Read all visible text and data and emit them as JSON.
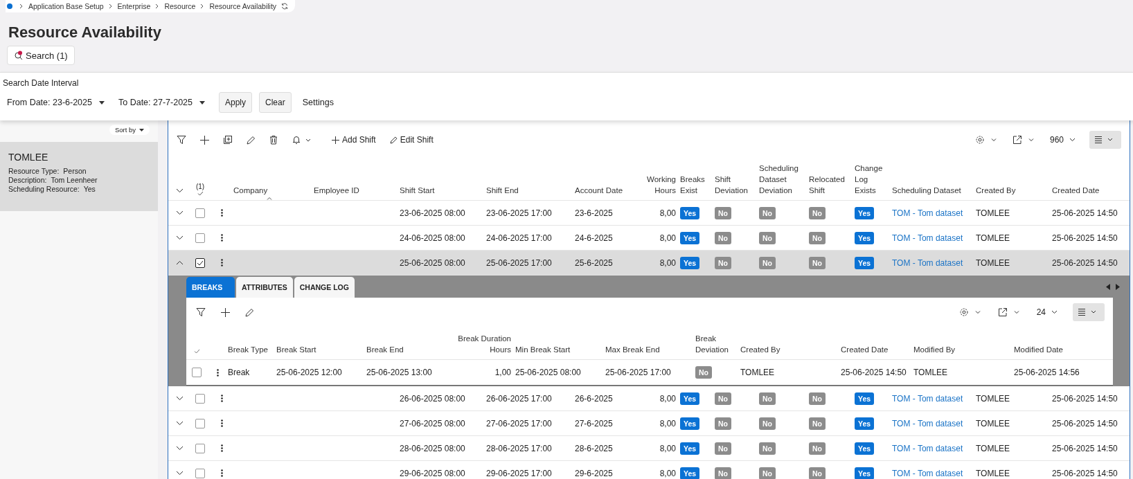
{
  "breadcrumb": [
    "Application Base Setup",
    "Enterprise",
    "Resource",
    "Resource Availability"
  ],
  "title": "Resource Availability",
  "search_button": "Search (1)",
  "filter_panel": {
    "heading": "Search Date Interval",
    "from_date": "From Date: 23-6-2025",
    "to_date": "To Date: 27-7-2025",
    "apply": "Apply",
    "clear": "Clear",
    "settings": "Settings"
  },
  "sidebar": {
    "sort_label": "Sort by",
    "items": [
      {
        "name": "TOMLEE",
        "selected": true,
        "fields": [
          {
            "label": "Resource Type:",
            "value": "Person"
          },
          {
            "label": "Description:",
            "value": "Tom Leenheer"
          },
          {
            "label": "Scheduling Resource:",
            "value": "Yes"
          }
        ]
      }
    ]
  },
  "toolbar": {
    "add_shift": "Add Shift",
    "edit_shift": "Edit Shift",
    "page_size": "960"
  },
  "table": {
    "selection_count": "(1)",
    "columns": [
      "Company",
      "Employee ID",
      "Shift Start",
      "Shift End",
      "Account Date",
      "Working Hours",
      "Breaks Exist",
      "Shift Deviation",
      "Scheduling Dataset Deviation",
      "Relocated Shift",
      "Change Log Exists",
      "Scheduling Dataset",
      "Created By",
      "Created Date"
    ],
    "rows": [
      {
        "expanded": false,
        "selected": false,
        "shift_start": "23-06-2025 08:00",
        "shift_end": "23-06-2025 17:00",
        "account_date": "23-6-2025",
        "working_hours": "8,00",
        "flags": [
          {
            "label": "Yes",
            "on": true
          },
          {
            "label": "No",
            "on": false
          },
          {
            "label": "No",
            "on": false
          },
          {
            "label": "No",
            "on": false
          },
          {
            "label": "Yes",
            "on": true
          }
        ],
        "dataset": "TOM - Tom dataset",
        "created_by": "TOMLEE",
        "created_date": "25-06-2025 14:50"
      },
      {
        "expanded": false,
        "selected": false,
        "shift_start": "24-06-2025 08:00",
        "shift_end": "24-06-2025 17:00",
        "account_date": "24-6-2025",
        "working_hours": "8,00",
        "flags": [
          {
            "label": "Yes",
            "on": true
          },
          {
            "label": "No",
            "on": false
          },
          {
            "label": "No",
            "on": false
          },
          {
            "label": "No",
            "on": false
          },
          {
            "label": "Yes",
            "on": true
          }
        ],
        "dataset": "TOM - Tom dataset",
        "created_by": "TOMLEE",
        "created_date": "25-06-2025 14:50"
      },
      {
        "expanded": true,
        "selected": true,
        "shift_start": "25-06-2025 08:00",
        "shift_end": "25-06-2025 17:00",
        "account_date": "25-6-2025",
        "working_hours": "8,00",
        "flags": [
          {
            "label": "Yes",
            "on": true
          },
          {
            "label": "No",
            "on": false
          },
          {
            "label": "No",
            "on": false
          },
          {
            "label": "No",
            "on": false
          },
          {
            "label": "Yes",
            "on": true
          }
        ],
        "dataset": "TOM - Tom dataset",
        "created_by": "TOMLEE",
        "created_date": "25-06-2025 14:50"
      },
      {
        "expanded": false,
        "selected": false,
        "shift_start": "26-06-2025 08:00",
        "shift_end": "26-06-2025 17:00",
        "account_date": "26-6-2025",
        "working_hours": "8,00",
        "flags": [
          {
            "label": "Yes",
            "on": true
          },
          {
            "label": "No",
            "on": false
          },
          {
            "label": "No",
            "on": false
          },
          {
            "label": "No",
            "on": false
          },
          {
            "label": "Yes",
            "on": true
          }
        ],
        "dataset": "TOM - Tom dataset",
        "created_by": "TOMLEE",
        "created_date": "25-06-2025 14:50"
      },
      {
        "expanded": false,
        "selected": false,
        "shift_start": "27-06-2025 08:00",
        "shift_end": "27-06-2025 17:00",
        "account_date": "27-6-2025",
        "working_hours": "8,00",
        "flags": [
          {
            "label": "Yes",
            "on": true
          },
          {
            "label": "No",
            "on": false
          },
          {
            "label": "No",
            "on": false
          },
          {
            "label": "No",
            "on": false
          },
          {
            "label": "Yes",
            "on": true
          }
        ],
        "dataset": "TOM - Tom dataset",
        "created_by": "TOMLEE",
        "created_date": "25-06-2025 14:50"
      },
      {
        "expanded": false,
        "selected": false,
        "shift_start": "28-06-2025 08:00",
        "shift_end": "28-06-2025 17:00",
        "account_date": "28-6-2025",
        "working_hours": "8,00",
        "flags": [
          {
            "label": "Yes",
            "on": true
          },
          {
            "label": "No",
            "on": false
          },
          {
            "label": "No",
            "on": false
          },
          {
            "label": "No",
            "on": false
          },
          {
            "label": "Yes",
            "on": true
          }
        ],
        "dataset": "TOM - Tom dataset",
        "created_by": "TOMLEE",
        "created_date": "25-06-2025 14:50"
      },
      {
        "expanded": false,
        "selected": false,
        "shift_start": "29-06-2025 08:00",
        "shift_end": "29-06-2025 17:00",
        "account_date": "29-6-2025",
        "working_hours": "8,00",
        "flags": [
          {
            "label": "Yes",
            "on": true
          },
          {
            "label": "No",
            "on": false
          },
          {
            "label": "No",
            "on": false
          },
          {
            "label": "No",
            "on": false
          },
          {
            "label": "Yes",
            "on": true
          }
        ],
        "dataset": "TOM - Tom dataset",
        "created_by": "TOMLEE",
        "created_date": "25-06-2025 14:50"
      }
    ]
  },
  "detail": {
    "tabs": [
      {
        "label": "BREAKS",
        "selected": true
      },
      {
        "label": "ATTRIBUTES",
        "selected": false
      },
      {
        "label": "CHANGE LOG",
        "selected": false
      }
    ],
    "page_size": "24",
    "columns": [
      "Break Type",
      "Break Start",
      "Break End",
      "Break Duration Hours",
      "Min Break Start",
      "Max Break End",
      "Break Deviation",
      "Created By",
      "Created Date",
      "Modified By",
      "Modified Date"
    ],
    "rows": [
      {
        "selected": false,
        "break_type": "Break",
        "break_start": "25-06-2025 12:00",
        "break_end": "25-06-2025 13:00",
        "duration": "1,00",
        "min_start": "25-06-2025 08:00",
        "max_end": "25-06-2025 17:00",
        "deviation": {
          "label": "No",
          "on": false
        },
        "created_by": "TOMLEE",
        "created_date": "25-06-2025 14:50",
        "modified_by": "TOMLEE",
        "modified_date": "25-06-2025 14:56"
      }
    ]
  }
}
